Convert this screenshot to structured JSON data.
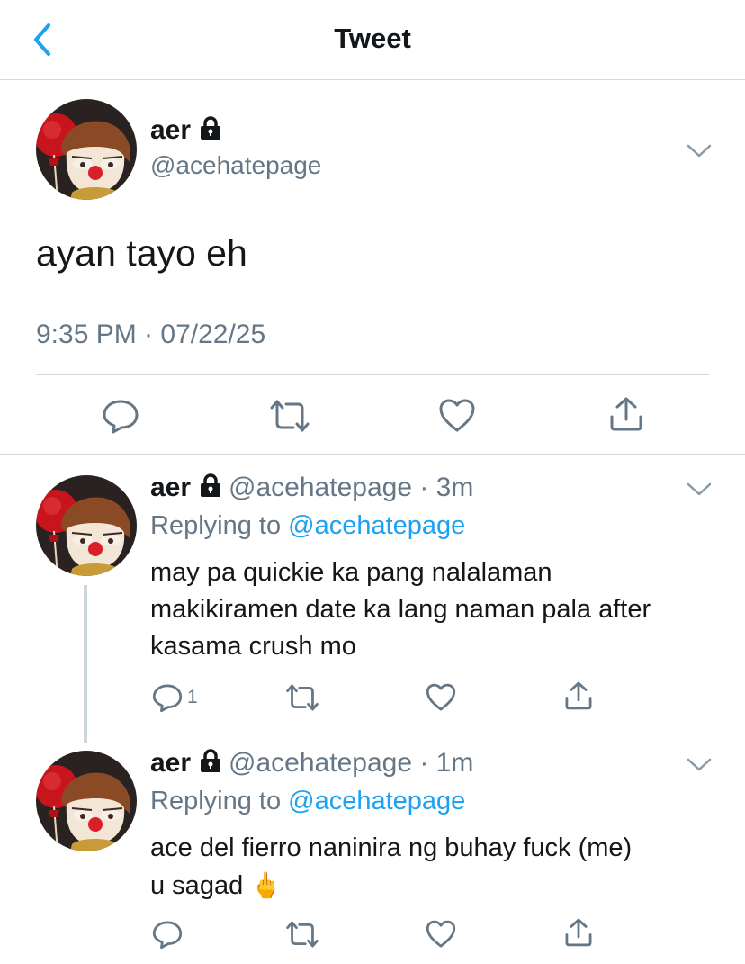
{
  "header": {
    "title": "Tweet"
  },
  "main_tweet": {
    "name": "aer",
    "handle": "@acehatepage",
    "text": "ayan tayo eh",
    "timestamp": "9:35 PM · 07/22/25"
  },
  "replies": [
    {
      "name": "aer",
      "meta": "@acehatepage · 3m",
      "replying_prefix": "Replying to ",
      "replying_to": "@acehatepage",
      "text_lines": [
        "may pa quickie ka pang nalalaman",
        "makikiramen date ka lang naman pala after",
        "kasama crush mo"
      ],
      "reply_count": "1"
    },
    {
      "name": "aer",
      "meta": "@acehatepage · 1m",
      "replying_prefix": "Replying to ",
      "replying_to": "@acehatepage",
      "text_lines": [
        "ace del fierro naninira ng buhay fuck (me)",
        "u sagad"
      ],
      "emoji": "🖕"
    }
  ],
  "icons": {
    "back": "chevron-left-icon",
    "lock": "lock-icon",
    "caret": "chevron-down-icon",
    "reply": "reply-icon",
    "retweet": "retweet-icon",
    "like": "heart-icon",
    "share": "share-icon"
  },
  "colors": {
    "accent": "#1da1f2",
    "secondary_text": "#657786",
    "divider": "#d6d9db"
  }
}
